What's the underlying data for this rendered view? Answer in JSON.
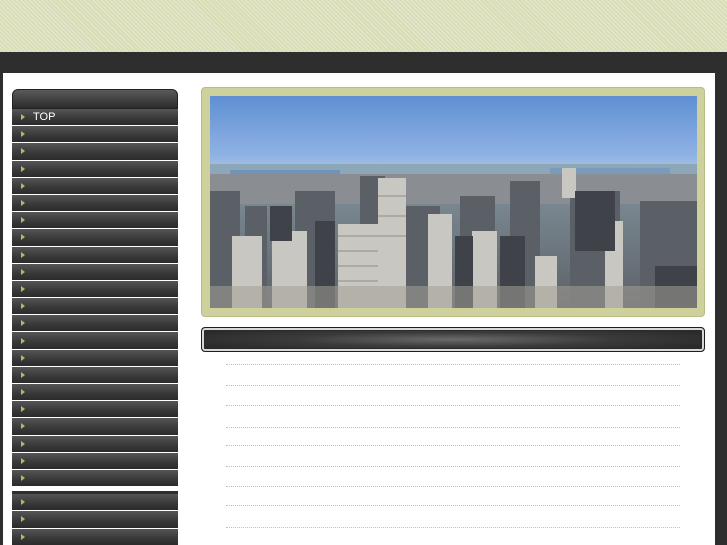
{
  "sidebar": {
    "group1": [
      {
        "label": "TOP"
      },
      {
        "label": ""
      },
      {
        "label": ""
      },
      {
        "label": ""
      },
      {
        "label": ""
      },
      {
        "label": ""
      },
      {
        "label": ""
      },
      {
        "label": ""
      },
      {
        "label": ""
      },
      {
        "label": ""
      },
      {
        "label": ""
      },
      {
        "label": ""
      },
      {
        "label": ""
      },
      {
        "label": ""
      },
      {
        "label": ""
      },
      {
        "label": ""
      },
      {
        "label": ""
      },
      {
        "label": ""
      },
      {
        "label": ""
      },
      {
        "label": ""
      },
      {
        "label": ""
      },
      {
        "label": ""
      }
    ],
    "group2": [
      {
        "label": ""
      },
      {
        "label": ""
      },
      {
        "label": ""
      },
      {
        "label": ""
      }
    ]
  },
  "hero": {
    "image_subject": "city-skyline-icon"
  },
  "section": {
    "title": ""
  },
  "colors": {
    "banner": "#d9dcb6",
    "dark": "#2e2e2e",
    "hero_frame": "#cfd19d",
    "menu_arrow": "#a8c060"
  }
}
